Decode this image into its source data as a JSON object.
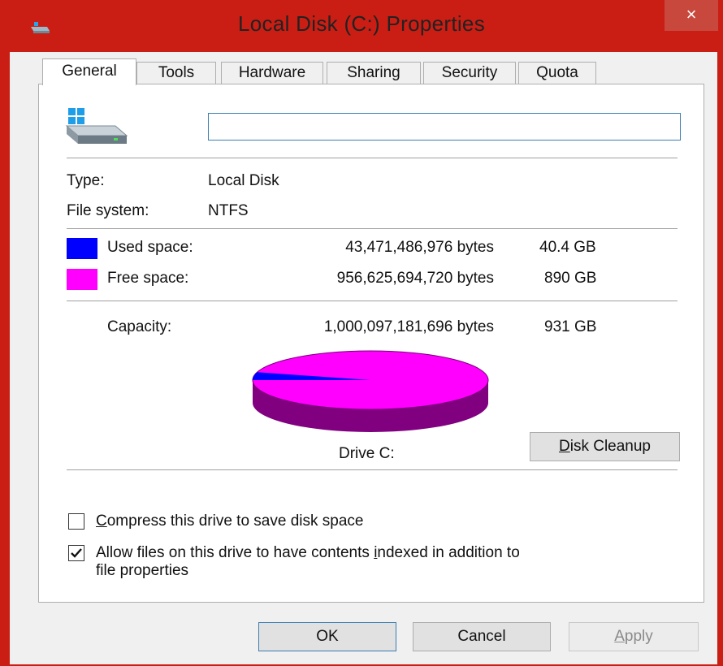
{
  "window": {
    "title": "Local Disk (C:) Properties",
    "close_glyph": "×",
    "title_icon": "drive-icon"
  },
  "tabs": [
    {
      "label": "General",
      "active": true
    },
    {
      "label": "Tools",
      "active": false
    },
    {
      "label": "Hardware",
      "active": false
    },
    {
      "label": "Sharing",
      "active": false
    },
    {
      "label": "Security",
      "active": false
    },
    {
      "label": "Quota",
      "active": false
    }
  ],
  "general": {
    "drive_icon": "windows-drive-icon",
    "name_value": "",
    "type_label": "Type:",
    "type_value": "Local Disk",
    "fs_label": "File system:",
    "fs_value": "NTFS",
    "used": {
      "label": "Used space:",
      "bytes": "43,471,486,976 bytes",
      "size": "40.4 GB",
      "color": "#0000ff"
    },
    "free": {
      "label": "Free space:",
      "bytes": "956,625,694,720 bytes",
      "size": "890 GB",
      "color": "#ff00ff"
    },
    "capacity": {
      "label": "Capacity:",
      "bytes": "1,000,097,181,696 bytes",
      "size": "931 GB"
    },
    "drive_caption": "Drive C:",
    "cleanup_mnemonic": "D",
    "cleanup_rest": "isk Cleanup"
  },
  "chart_data": {
    "type": "pie",
    "categories": [
      "Used space",
      "Free space"
    ],
    "values": [
      43471486976,
      956625694720
    ],
    "colors": [
      "#0000ff",
      "#ff00ff"
    ],
    "side_color": "#800080"
  },
  "options": {
    "compress": {
      "checked": false,
      "mnemonic": "C",
      "rest": "ompress this drive to save disk space"
    },
    "index": {
      "checked": true,
      "before": "Allow files on this drive to have contents ",
      "mnemonic": "i",
      "after": "ndexed in addition to",
      "line2": "file properties"
    }
  },
  "buttons": {
    "ok": "OK",
    "cancel": "Cancel",
    "apply_mnemonic": "A",
    "apply_rest": "pply"
  }
}
